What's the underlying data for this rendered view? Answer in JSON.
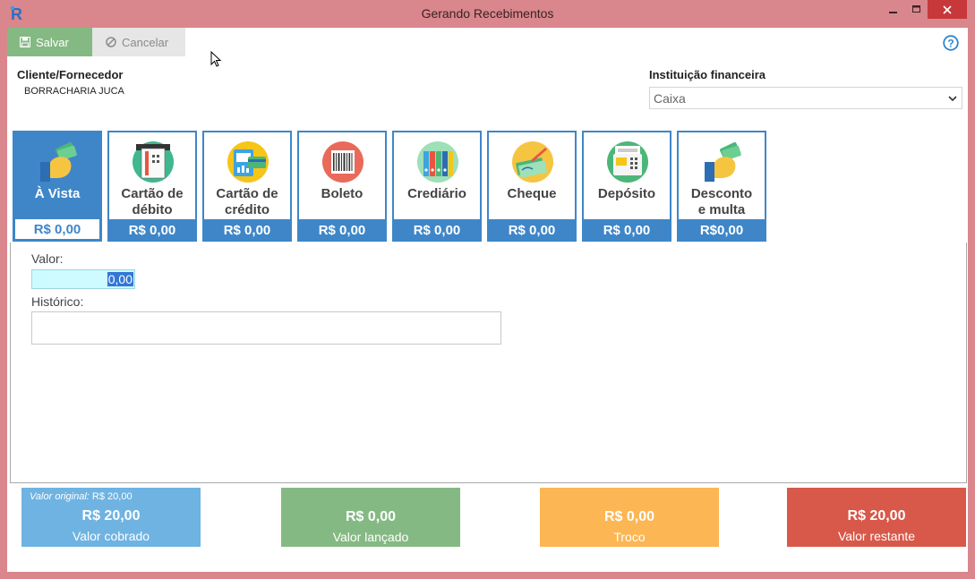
{
  "window": {
    "title": "Gerando Recebimentos",
    "logo_letter": "R"
  },
  "toolbar": {
    "save_label": "Salvar",
    "cancel_label": "Cancelar"
  },
  "client": {
    "label": "Cliente/Fornecedor",
    "name": "BORRACHARIA JUCA"
  },
  "institution": {
    "label": "Instituição financeira",
    "selected": "Caixa"
  },
  "payment_methods": [
    {
      "label": "À Vista",
      "value": "R$ 0,00",
      "icon": "money-hand-icon",
      "active": true
    },
    {
      "label": "Cartão de\ndébito",
      "value": "R$ 0,00",
      "icon": "debit-card-icon",
      "active": false
    },
    {
      "label": "Cartão de\ncrédito",
      "value": "R$ 0,00",
      "icon": "credit-card-icon",
      "active": false
    },
    {
      "label": "Boleto",
      "value": "R$ 0,00",
      "icon": "barcode-icon",
      "active": false
    },
    {
      "label": "Crediário",
      "value": "R$ 0,00",
      "icon": "binders-icon",
      "active": false
    },
    {
      "label": "Cheque",
      "value": "R$ 0,00",
      "icon": "check-signing-icon",
      "active": false
    },
    {
      "label": "Depósito",
      "value": "R$ 0,00",
      "icon": "deposit-machine-icon",
      "active": false
    },
    {
      "label": "Desconto\ne multa",
      "value": "R$0,00",
      "icon": "money-hand-icon",
      "active": false
    }
  ],
  "form": {
    "valor_label": "Valor:",
    "valor_value": "0,00",
    "historico_label": "Histórico:",
    "historico_value": ""
  },
  "summary": {
    "original_label": "Valor original:",
    "original_value": "R$ 20,00",
    "cobrado_value": "R$ 20,00",
    "cobrado_label": "Valor cobrado",
    "lancado_value": "R$ 0,00",
    "lancado_label": "Valor lançado",
    "troco_value": "R$ 0,00",
    "troco_label": "Troco",
    "restante_value": "R$ 20,00",
    "restante_label": "Valor restante"
  },
  "colors": {
    "titlebar": "#d9868c",
    "save_button": "#85b983",
    "tile_blue": "#3f86c8",
    "cobrado": "#6fb3e2",
    "lancado": "#85b983",
    "troco": "#fcb653",
    "restante": "#d8584a",
    "close_button": "#c7383a"
  }
}
